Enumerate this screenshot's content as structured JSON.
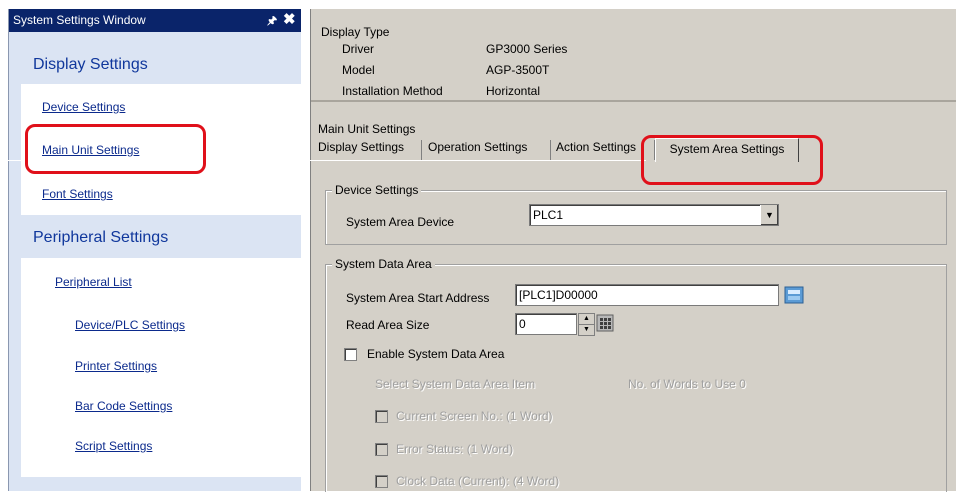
{
  "left_panel": {
    "title": "System Settings Window",
    "pin_glyph": "Ѩ",
    "close_glyph": "✖",
    "display_header": "Display Settings",
    "display_items": [
      "Device Settings",
      "Main Unit Settings",
      "Font Settings"
    ],
    "peripheral_header": "Peripheral Settings",
    "peripheral_items": [
      "Peripheral List",
      "Device/PLC Settings",
      "Printer Settings",
      "Bar Code Settings",
      "Script Settings"
    ]
  },
  "display_type": {
    "heading": "Display Type",
    "rows": [
      {
        "label": "Driver",
        "value": "GP3000 Series"
      },
      {
        "label": "Model",
        "value": "AGP-3500T"
      },
      {
        "label": "Installation Method",
        "value": "Horizontal"
      }
    ]
  },
  "main_unit": {
    "heading": "Main Unit Settings",
    "tabs": [
      "Display Settings",
      "Operation Settings",
      "Action Settings",
      "System Area Settings"
    ],
    "active_tab": "System Area Settings"
  },
  "device_settings": {
    "group_title": "Device Settings",
    "system_area_device_label": "System Area Device",
    "system_area_device_value": "PLC1"
  },
  "system_data_area": {
    "group_title": "System Data Area",
    "start_address_label": "System Area Start Address",
    "start_address_value": "[PLC1]D00000",
    "read_area_label": "Read Area Size",
    "read_area_value": "0",
    "enable_label": "Enable System Data Area",
    "select_item_label": "Select System Data Area Item",
    "words_to_use": "No. of Words to Use 0",
    "items": [
      "Current Screen No.: (1 Word)",
      "Error Status: (1 Word)",
      "Clock Data (Current): (4 Word)"
    ]
  },
  "colors": {
    "title_bar": "#0a246a",
    "link": "#0b2a8c",
    "highlight": "#e0101a",
    "header": "#10379c"
  }
}
